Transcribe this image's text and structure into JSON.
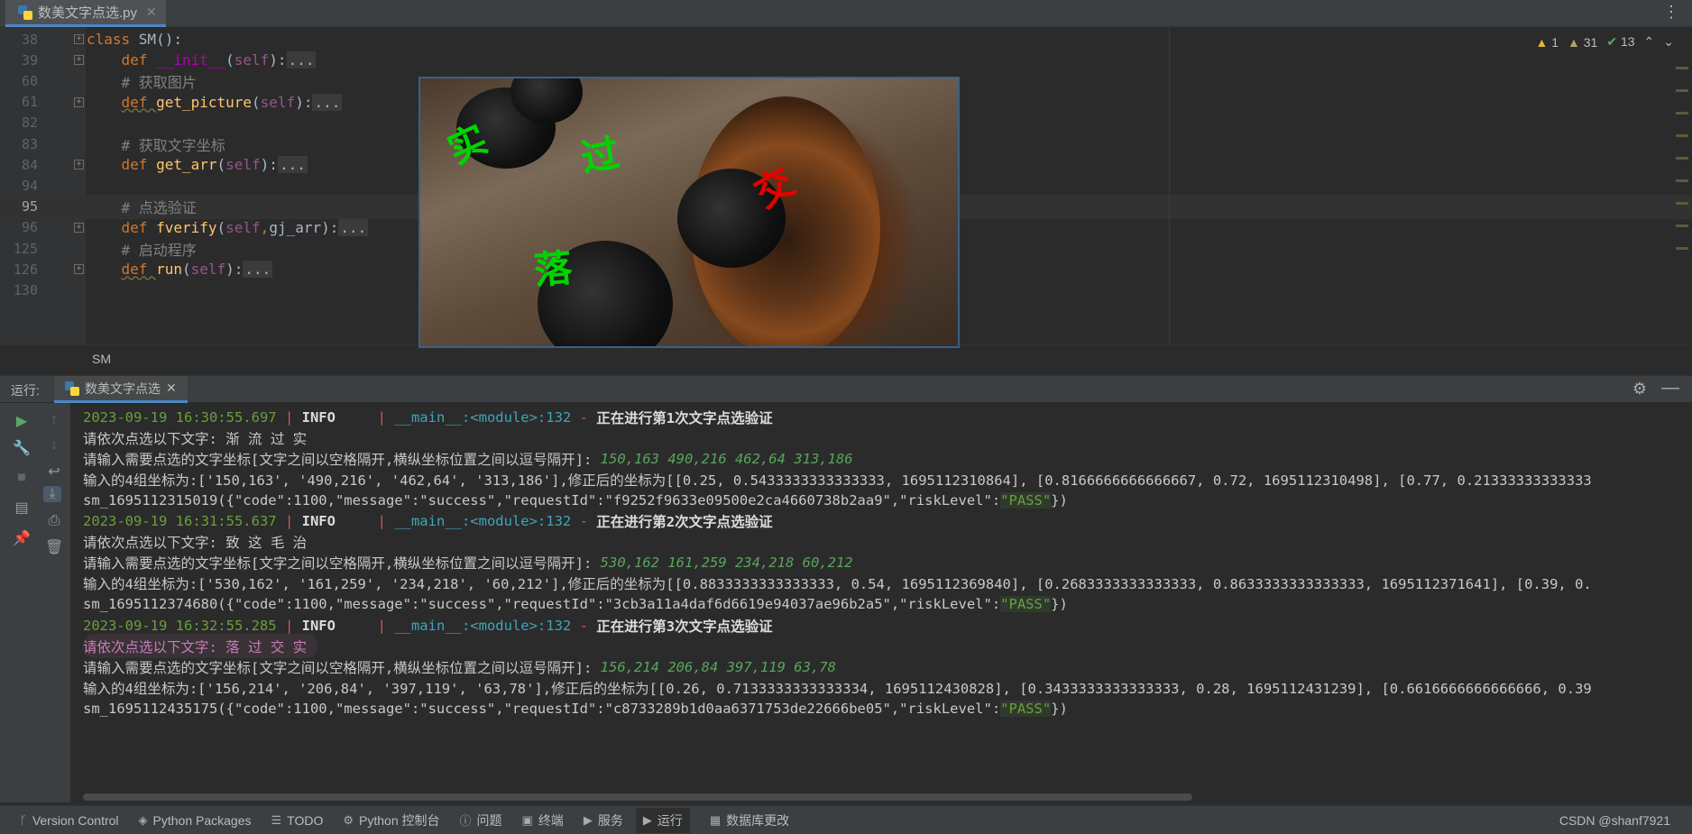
{
  "tab": {
    "filename": "数美文字点选.py"
  },
  "editor": {
    "lines": [
      {
        "num": "38",
        "tokens": [
          [
            "kw",
            "class "
          ],
          [
            "cls",
            "SM():"
          ]
        ]
      },
      {
        "num": "39",
        "tokens": [
          [
            "sp",
            "    "
          ],
          [
            "kw",
            "def "
          ],
          [
            "magic",
            "__init__"
          ],
          [
            "cls",
            "("
          ],
          [
            "self",
            "self"
          ],
          [
            "cls",
            "):"
          ],
          [
            "box",
            "..."
          ]
        ]
      },
      {
        "num": "60",
        "tokens": [
          [
            "sp",
            "    "
          ],
          [
            "cmt",
            "# 获取图片"
          ]
        ]
      },
      {
        "num": "61",
        "tokens": [
          [
            "sp",
            "    "
          ],
          [
            "kwsq",
            "def "
          ],
          [
            "fn",
            "get_picture"
          ],
          [
            "cls",
            "("
          ],
          [
            "self",
            "self"
          ],
          [
            "cls",
            "):"
          ],
          [
            "box",
            "..."
          ]
        ]
      },
      {
        "num": "82",
        "tokens": []
      },
      {
        "num": "83",
        "tokens": [
          [
            "sp",
            "    "
          ],
          [
            "cmt",
            "# 获取文字坐标"
          ]
        ]
      },
      {
        "num": "84",
        "tokens": [
          [
            "sp",
            "    "
          ],
          [
            "kw",
            "def "
          ],
          [
            "fn",
            "get_arr"
          ],
          [
            "cls",
            "("
          ],
          [
            "self",
            "self"
          ],
          [
            "cls",
            "):"
          ],
          [
            "box",
            "..."
          ]
        ]
      },
      {
        "num": "94",
        "tokens": []
      },
      {
        "num": "95",
        "tokens": [
          [
            "sp",
            "    "
          ],
          [
            "cmt",
            "# 点选验证"
          ]
        ]
      },
      {
        "num": "96",
        "tokens": [
          [
            "sp",
            "    "
          ],
          [
            "kw",
            "def "
          ],
          [
            "fn",
            "fverify"
          ],
          [
            "cls",
            "("
          ],
          [
            "self",
            "self"
          ],
          [
            "kw",
            ","
          ],
          [
            "cls",
            "gj_arr):"
          ],
          [
            "box",
            "..."
          ]
        ]
      },
      {
        "num": "125",
        "tokens": [
          [
            "sp",
            "    "
          ],
          [
            "cmt",
            "# 启动程序"
          ]
        ]
      },
      {
        "num": "126",
        "tokens": [
          [
            "sp",
            "    "
          ],
          [
            "kwsq",
            "def "
          ],
          [
            "fn",
            "run"
          ],
          [
            "cls",
            "("
          ],
          [
            "self",
            "self"
          ],
          [
            "cls",
            "):"
          ],
          [
            "box",
            "..."
          ]
        ]
      },
      {
        "num": "130",
        "tokens": []
      }
    ],
    "inspections": {
      "warnings": "1",
      "weak_warnings": "31",
      "ok": "13"
    },
    "breadcrumb": "SM"
  },
  "captcha": {
    "chars": [
      {
        "text": "实",
        "color": "green"
      },
      {
        "text": "过",
        "color": "green"
      },
      {
        "text": "交",
        "color": "red"
      },
      {
        "text": "落",
        "color": "green"
      }
    ]
  },
  "run": {
    "label": "运行:",
    "tab_label": "数美文字点选",
    "lines": [
      {
        "type": "log",
        "ts": "2023-09-19 16:30:55.697",
        "level": "INFO",
        "module": "__main__:<module>:132",
        "msg": "正在进行第1次文字点选验证"
      },
      {
        "type": "plain",
        "text": "请依次点选以下文字: 渐 流 过 实"
      },
      {
        "type": "input",
        "text": "请输入需要点选的文字坐标[文字之间以空格隔开,横纵坐标位置之间以逗号隔开]: ",
        "value": "150,163 490,216 462,64 313,186"
      },
      {
        "type": "plain",
        "text": "输入的4组坐标为:['150,163', '490,216', '462,64', '313,186'],修正后的坐标为[[0.25, 0.5433333333333333, 1695112310864], [0.8166666666666667, 0.72, 1695112310498], [0.77, 0.21333333333333"
      },
      {
        "type": "result",
        "pre": "sm_1695112315019({\"code\":1100,\"message\":\"success\",\"requestId\":\"f9252f9633e09500e2ca4660738b2aa9\",\"riskLevel\":",
        "pass": "\"PASS\"",
        "post": "})"
      },
      {
        "type": "log",
        "ts": "2023-09-19 16:31:55.637",
        "level": "INFO",
        "module": "__main__:<module>:132",
        "msg": "正在进行第2次文字点选验证"
      },
      {
        "type": "plain",
        "text": "请依次点选以下文字: 致 这 毛 治"
      },
      {
        "type": "input",
        "text": "请输入需要点选的文字坐标[文字之间以空格隔开,横纵坐标位置之间以逗号隔开]: ",
        "value": "530,162 161,259 234,218 60,212"
      },
      {
        "type": "plain",
        "text": "输入的4组坐标为:['530,162', '161,259', '234,218', '60,212'],修正后的坐标为[[0.8833333333333333, 0.54, 1695112369840], [0.2683333333333333, 0.8633333333333333, 1695112371641], [0.39, 0."
      },
      {
        "type": "result",
        "pre": "sm_1695112374680({\"code\":1100,\"message\":\"success\",\"requestId\":\"3cb3a11a4daf6d6619e94037ae96b2a5\",\"riskLevel\":",
        "pass": "\"PASS\"",
        "post": "})"
      },
      {
        "type": "log",
        "ts": "2023-09-19 16:32:55.285",
        "level": "INFO",
        "module": "__main__:<module>:132",
        "msg": "正在进行第3次文字点选验证"
      },
      {
        "type": "highlight",
        "text": "请依次点选以下文字: 落 过 交 实"
      },
      {
        "type": "input",
        "text": "请输入需要点选的文字坐标[文字之间以空格隔开,横纵坐标位置之间以逗号隔开]: ",
        "value": "156,214 206,84 397,119 63,78"
      },
      {
        "type": "plain",
        "text": "输入的4组坐标为:['156,214', '206,84', '397,119', '63,78'],修正后的坐标为[[0.26, 0.7133333333333334, 1695112430828], [0.3433333333333333, 0.28, 1695112431239], [0.6616666666666666, 0.39"
      },
      {
        "type": "result",
        "pre": "sm_1695112435175({\"code\":1100,\"message\":\"success\",\"requestId\":\"c8733289b1d0aa6371753de22666be05\",\"riskLevel\":",
        "pass": "\"PASS\"",
        "post": "})"
      }
    ]
  },
  "statusbar": {
    "items": [
      {
        "icon": "branch-icon",
        "glyph": "ᚴ",
        "label": "Version Control"
      },
      {
        "icon": "packages-icon",
        "glyph": "◈",
        "label": "Python Packages"
      },
      {
        "icon": "todo-icon",
        "glyph": "☰",
        "label": "TODO"
      },
      {
        "icon": "python-console-icon",
        "glyph": "⚙",
        "label": "Python 控制台"
      },
      {
        "icon": "problems-icon",
        "glyph": "ⓘ",
        "label": "问题"
      },
      {
        "icon": "terminal-icon",
        "glyph": "▣",
        "label": "终端"
      },
      {
        "icon": "services-icon",
        "glyph": "▶",
        "label": "服务"
      },
      {
        "icon": "run-icon",
        "glyph": "▶",
        "label": "运行",
        "active": true
      },
      {
        "icon": "database-icon",
        "glyph": "▦",
        "label": "数据库更改"
      }
    ],
    "right": "CSDN @shanf7921"
  }
}
